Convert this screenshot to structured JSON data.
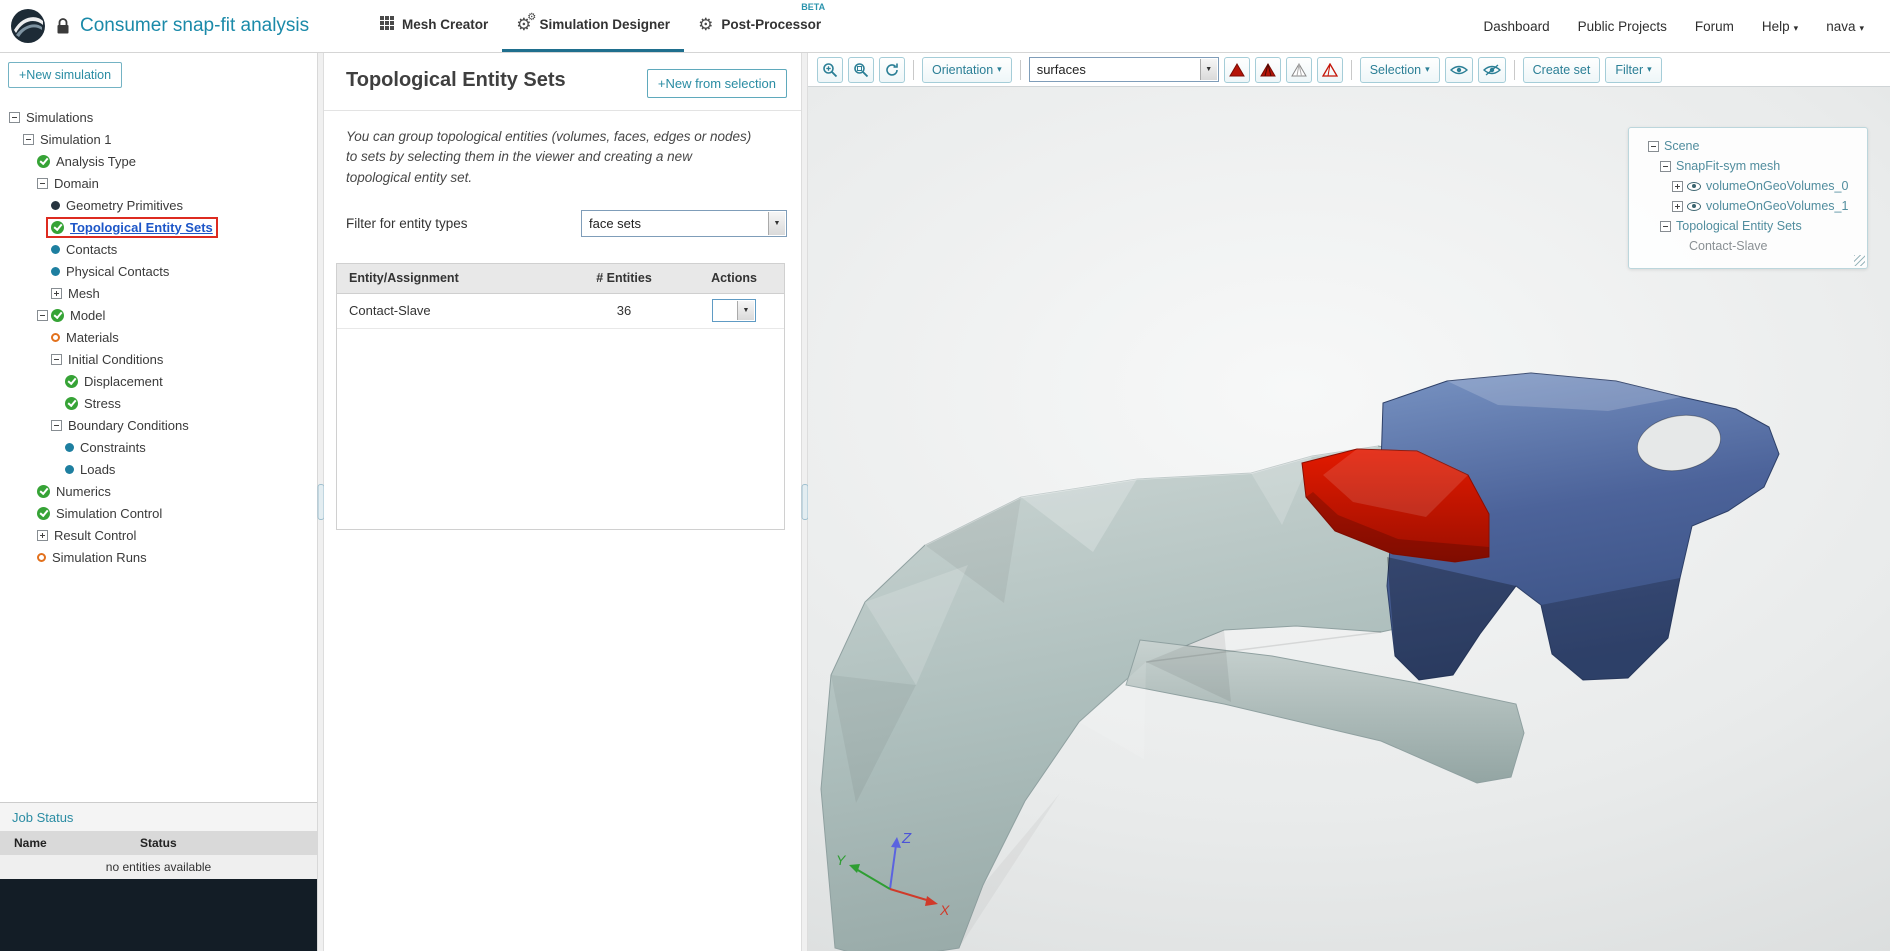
{
  "colors": {
    "accent_teal": "#2a8ca3",
    "active_tab_underline": "#1f6f8e",
    "selected_item_blue": "#1d56c8",
    "selection_highlight_red": "#dd2b20",
    "model_gray": "#a9bab8",
    "model_blue": "#3f5a8f",
    "model_red": "#c41500",
    "job_status_dark": "#131d26"
  },
  "topbar": {
    "project_title": "Consumer snap-fit analysis",
    "tabs": [
      {
        "label": "Mesh Creator"
      },
      {
        "label": "Simulation Designer"
      },
      {
        "label": "Post-Processor",
        "badge": "BETA"
      }
    ],
    "links": {
      "dashboard": "Dashboard",
      "public_projects": "Public Projects",
      "forum": "Forum",
      "help": "Help",
      "user": "nava"
    }
  },
  "sidebar": {
    "new_simulation_label": "+New simulation",
    "tree": [
      {
        "label": "Simulations",
        "icons": [
          "minus"
        ],
        "level": 0
      },
      {
        "label": "Simulation 1",
        "icons": [
          "minus"
        ],
        "level": 1
      },
      {
        "label": "Analysis Type",
        "icons": [
          "check"
        ],
        "level": 2
      },
      {
        "label": "Domain",
        "icons": [
          "minus"
        ],
        "level": 2
      },
      {
        "label": "Geometry Primitives",
        "icons": [
          "dot-dark"
        ],
        "level": 3
      },
      {
        "label": "Topological Entity Sets",
        "icons": [
          "check"
        ],
        "level": 3,
        "selected": true
      },
      {
        "label": "Contacts",
        "icons": [
          "dot-blue"
        ],
        "level": 3
      },
      {
        "label": "Physical Contacts",
        "icons": [
          "dot-blue"
        ],
        "level": 3
      },
      {
        "label": "Mesh",
        "icons": [
          "plus"
        ],
        "level": 3
      },
      {
        "label": "Model",
        "icons": [
          "minus",
          "check"
        ],
        "level": 2
      },
      {
        "label": "Materials",
        "icons": [
          "circle-orange"
        ],
        "level": 3
      },
      {
        "label": "Initial Conditions",
        "icons": [
          "minus"
        ],
        "level": 3
      },
      {
        "label": "Displacement",
        "icons": [
          "check"
        ],
        "level": 4
      },
      {
        "label": "Stress",
        "icons": [
          "check"
        ],
        "level": 4
      },
      {
        "label": "Boundary Conditions",
        "icons": [
          "minus"
        ],
        "level": 3
      },
      {
        "label": "Constraints",
        "icons": [
          "dot-blue"
        ],
        "level": 4
      },
      {
        "label": "Loads",
        "icons": [
          "dot-blue"
        ],
        "level": 4
      },
      {
        "label": "Numerics",
        "icons": [
          "check"
        ],
        "level": 2
      },
      {
        "label": "Simulation Control",
        "icons": [
          "check"
        ],
        "level": 2
      },
      {
        "label": "Result Control",
        "icons": [
          "plus"
        ],
        "level": 2
      },
      {
        "label": "Simulation Runs",
        "icons": [
          "circle-orange"
        ],
        "level": 2
      }
    ],
    "job_status": {
      "title": "Job Status",
      "name_header": "Name",
      "status_header": "Status",
      "empty_text": "no entities available"
    }
  },
  "panel": {
    "title": "Topological Entity Sets",
    "new_from_selection_label": "+New from selection",
    "description": "You can group topological entities (volumes, faces, edges or nodes) to sets by selecting them in the viewer and creating a new topological entity set.",
    "filter_label": "Filter for entity types",
    "filter_value": "face sets",
    "table": {
      "headers": [
        "Entity/Assignment",
        "# Entities",
        "Actions"
      ],
      "rows": [
        {
          "name": "Contact-Slave",
          "count": "36"
        }
      ]
    }
  },
  "viewer": {
    "toolbar": {
      "zoom_icons": [
        "zoom-in",
        "zoom-window",
        "refresh"
      ],
      "orientation_label": "Orientation",
      "render_mode_value": "surfaces",
      "render_mode_icons": [
        "solid-red-triangle",
        "shaded-wire-triangle",
        "wireframe-triangle",
        "red-wireframe-triangle"
      ],
      "selection_label": "Selection",
      "eye_icons": [
        "show-eye",
        "hide-eye"
      ],
      "create_set_label": "Create set",
      "filter_label": "Filter"
    },
    "scene_tree": [
      {
        "label": "Scene",
        "icons": [
          "minus"
        ],
        "level": 0
      },
      {
        "label": "SnapFit-sym mesh",
        "icons": [
          "minus"
        ],
        "level": 1
      },
      {
        "label": "volumeOnGeoVolumes_0",
        "icons": [
          "plus",
          "eye"
        ],
        "level": 2
      },
      {
        "label": "volumeOnGeoVolumes_1",
        "icons": [
          "plus",
          "eye"
        ],
        "level": 2
      },
      {
        "label": "Topological Entity Sets",
        "icons": [
          "minus"
        ],
        "level": 1
      },
      {
        "label": "Contact-Slave",
        "icons": [],
        "level": 3,
        "muted": true
      }
    ],
    "axes": {
      "x": "X",
      "y": "Y",
      "z": "Z"
    }
  }
}
